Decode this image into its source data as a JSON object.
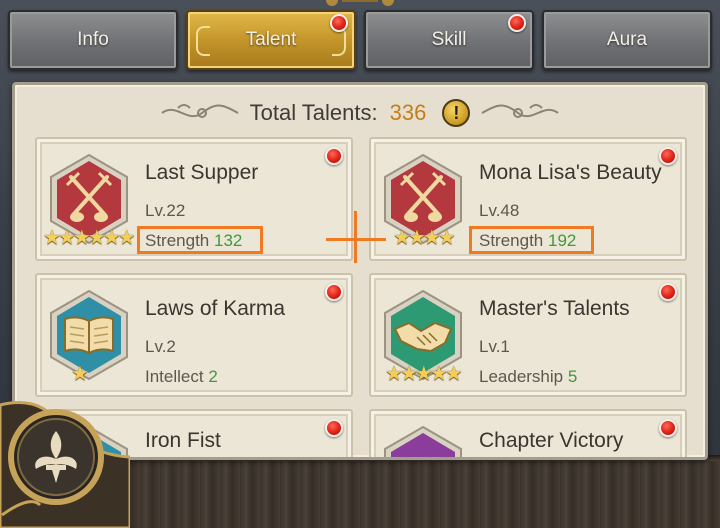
{
  "tabs": [
    {
      "label": "Info",
      "active": false,
      "notification": false
    },
    {
      "label": "Talent",
      "active": true,
      "notification": true
    },
    {
      "label": "Skill",
      "active": false,
      "notification": true
    },
    {
      "label": "Aura",
      "active": false,
      "notification": false
    }
  ],
  "header": {
    "label": "Total Talents:",
    "count": "336",
    "info_icon": "!"
  },
  "talents": [
    {
      "name": "Last Supper",
      "level": "Lv.22",
      "stars": 6,
      "stat_name": "Strength",
      "stat_value": "132",
      "icon": "crossed-swords-icon",
      "badge_color": "#b3393f",
      "highlighted": true
    },
    {
      "name": "Mona Lisa's Beauty",
      "level": "Lv.48",
      "stars": 4,
      "stat_name": "Strength",
      "stat_value": "192",
      "icon": "crossed-swords-icon",
      "badge_color": "#b3393f",
      "highlighted": true
    },
    {
      "name": "Laws of Karma",
      "level": "Lv.2",
      "stars": 1,
      "stat_name": "Intellect",
      "stat_value": "2",
      "icon": "open-book-icon",
      "badge_color": "#2f8fa6",
      "highlighted": false
    },
    {
      "name": "Master's Talents",
      "level": "Lv.1",
      "stars": 5,
      "stat_name": "Leadership",
      "stat_value": "5",
      "icon": "handshake-icon",
      "badge_color": "#2e9a74",
      "highlighted": false
    },
    {
      "name": "Iron Fist",
      "icon": "fist-icon",
      "badge_color": "#2f8fa6"
    },
    {
      "name": "Chapter Victory",
      "icon": "victory-icon",
      "badge_color": "#8a3d9a"
    }
  ],
  "colors": {
    "accent_gold": "#c47d17",
    "stat_green": "#3f9a3a",
    "highlight_orange": "#f07a22",
    "notification_red": "#e3261a"
  }
}
